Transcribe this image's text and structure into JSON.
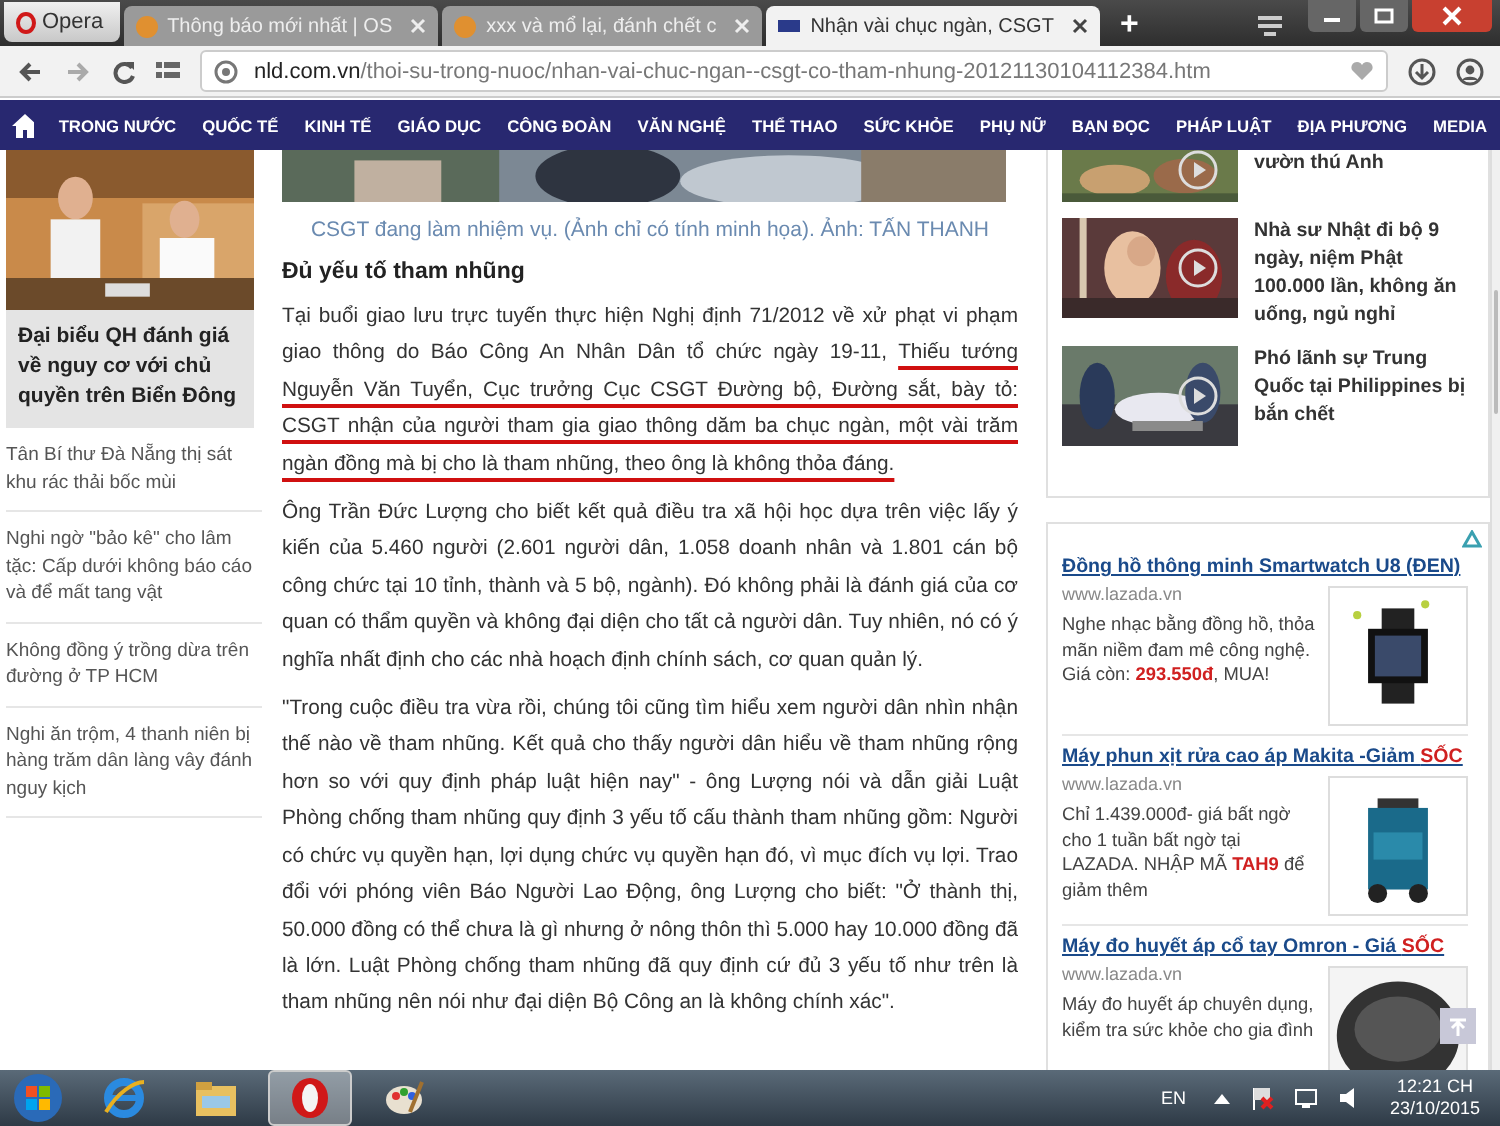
{
  "browser": {
    "menu_label": "Opera",
    "new_tab": "+",
    "tabs": [
      {
        "title": "Thông báo mới nhất | OS",
        "selected": false
      },
      {
        "title": "xxx và mổ lại, đánh chết c",
        "selected": false
      },
      {
        "title": "Nhận vài chục ngàn, CSGT",
        "selected": true
      }
    ]
  },
  "address": {
    "host": "nld.com.vn",
    "path": "/thoi-su-trong-nuoc/nhan-vai-chuc-ngan--csgt-co-tham-nhung-20121130104112384.htm"
  },
  "nav": {
    "items": [
      "TRONG NƯỚC",
      "QUỐC TẾ",
      "KINH TẾ",
      "GIÁO DỤC",
      "CÔNG ĐOÀN",
      "VĂN NGHỆ",
      "THỂ THAO",
      "SỨC KHỎE",
      "PHỤ NỮ",
      "BẠN ĐỌC",
      "PHÁP LUẬT",
      "ĐỊA PHƯƠNG",
      "MEDIA"
    ]
  },
  "left": {
    "featured": {
      "title": "Đại biểu QH đánh giá về nguy cơ với chủ quyền trên Biển Đông"
    },
    "links": [
      "Tân Bí thư Đà Nẵng thị sát khu rác thải bốc mùi",
      "Nghi ngờ \"bảo kê\" cho lâm tặc: Cấp dưới không báo cáo và để mất tang vật",
      "Không đồng ý trồng dừa trên đường ở TP HCM",
      "Nghi ăn trộm, 4 thanh niên bị hàng trăm dân làng vây đánh nguy kịch"
    ]
  },
  "article": {
    "caption": "CSGT đang làm nhiệm vụ. (Ảnh chỉ có tính minh họa). Ảnh: TẤN THANH",
    "heading": "Đủ yếu tố tham nhũng",
    "paragraphs": [
      {
        "segments": [
          {
            "text": "Tại buổi giao lưu trực tuyến thực hiện Nghị định 71/2012 về xử phạt vi phạm giao thông do Báo Công An Nhân Dân tổ chức ngày 19-11, ",
            "underlined": false
          },
          {
            "text": "Thiếu tướng Nguyễn Văn Tuyển, Cục trưởng Cục CSGT Đường bộ, Đường sắt, bày tỏ: CSGT nhận của người tham gia giao thông dăm ba chục ngàn, một vài trăm ngàn đồng mà bị cho là tham nhũng, theo ông là không thỏa đáng.",
            "underlined": true
          }
        ]
      },
      {
        "segments": [
          {
            "text": "Ông Trần Đức Lượng cho biết kết quả điều tra xã hội học dựa trên việc lấy ý kiến của 5.460 người (2.601 người dân, 1.058 doanh nhân và 1.801 cán bộ công chức tại 10 tỉnh, thành và 5 bộ, ngành). Đó không phải là đánh giá của cơ quan có thẩm quyền và không đại diện cho tất cả người dân. Tuy nhiên, nó có ý nghĩa nhất định cho các nhà hoạch định chính sách, cơ quan quản lý.",
            "underlined": false
          }
        ]
      },
      {
        "segments": [
          {
            "text": "\"Trong cuộc điều tra vừa rồi, chúng tôi cũng tìm hiểu xem người dân nhìn nhận thế nào về tham nhũng. Kết quả cho thấy người dân hiểu về tham nhũng rộng hơn so với quy định pháp luật hiện nay\" - ông Lượng nói và dẫn giải Luật Phòng chống tham nhũng quy định 3 yếu tố cấu thành tham nhũng gồm: Người có chức vụ quyền hạn, lợi dụng chức vụ quyền hạn đó, vì mục đích vụ lợi. Trao đổi với phóng viên Báo Người Lao Động, ông Lượng cho biết: \"Ở thành thị, 50.000 đồng có thể chưa là gì nhưng ở nông thôn thì 5.000 hay 10.000 đồng đã là lớn. Luật Phòng chống tham nhũng đã quy định cứ đủ 3 yếu tố như trên là tham nhũng nên nói như đại diện Bộ Công an là không chính xác\".",
            "underlined": false
          }
        ]
      }
    ]
  },
  "right": {
    "videos": [
      {
        "title": "vườn thú Anh"
      },
      {
        "title": "Nhà sư Nhật đi bộ 9 ngày, niệm Phật 100.000 lần, không ăn uống, ngủ nghỉ"
      },
      {
        "title": "Phó lãnh sự Trung Quốc tại Philippines bị bắn chết"
      }
    ],
    "ads": [
      {
        "title": "Đồng hồ thông minh Smartwatch U8 (ĐEN)",
        "url": "www.lazada.vn",
        "text": "Nghe nhạc bằng đồng hồ, thỏa mãn niềm đam mê công nghệ. Giá còn: **293.550đ**, MUA!"
      },
      {
        "title": "Máy phun xịt rửa cao áp Makita -Giảm **SỐC**",
        "url": "www.lazada.vn",
        "text": "Chỉ 1.439.000đ- giá bất ngờ cho 1 tuần bất ngờ tại LAZADA. NHẬP MÃ **TAH9** để giảm thêm"
      },
      {
        "title": "Máy đo huyết áp cổ tay Omron - Giá **SỐC**",
        "url": "www.lazada.vn",
        "text": "Máy đo huyết áp chuyên dụng, kiểm tra sức khỏe cho gia đình"
      }
    ]
  },
  "taskbar": {
    "language": "EN",
    "time": "12:21 CH",
    "date": "23/10/2015"
  }
}
